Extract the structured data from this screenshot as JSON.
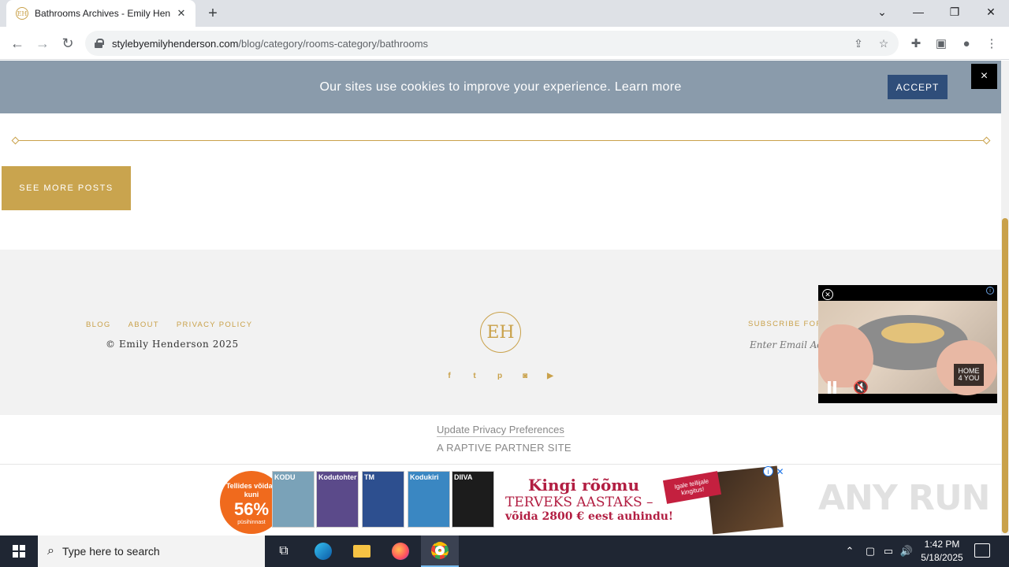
{
  "browser": {
    "tab_title": "Bathrooms Archives - Emily Hen",
    "tab_favicon": "EH",
    "url_host": "stylebyemilyhenderson.com",
    "url_path": "/blog/category/rooms-category/bathrooms"
  },
  "cookie_bar": {
    "text": "Our sites use cookies to improve your experience.",
    "learn_more": "Learn more",
    "accept_label": "ACCEPT",
    "close_label": "×"
  },
  "main": {
    "see_more_label": "SEE MORE POSTS"
  },
  "footer": {
    "nav": [
      "BLOG",
      "ABOUT",
      "PRIVACY POLICY"
    ],
    "copyright": "© Emily Henderson 2025",
    "logo_text": "EH",
    "socials": [
      "facebook-icon",
      "twitter-icon",
      "pinterest-icon",
      "instagram-icon",
      "youtube-icon"
    ],
    "subscribe_label": "SUBSCRIBE FOR",
    "email_placeholder": "Enter Email Ad"
  },
  "legal": {
    "privacy_link": "Update Privacy Preferences",
    "partner": "A RAPTIVE PARTNER SITE"
  },
  "video": {
    "brand_line1": "HOME",
    "brand_line2": "4 YOU"
  },
  "ad": {
    "badge_line1": "Tellides võidad kuni",
    "badge_percent": "56%",
    "badge_line3": "püsihinnast",
    "magazines": [
      "KODU",
      "Kodutohter",
      "TM",
      "Kodukiri",
      "DIIVA"
    ],
    "headline": "Kingi rõõmu",
    "sub1": "TERVEKS AASTAKS –",
    "sub2": "võida 2800 € eest auhindu!",
    "ribbon": "Igale tellijale kingitus!"
  },
  "watermark": "ANY RUN",
  "taskbar": {
    "search_placeholder": "Type here to search",
    "time": "1:42 PM",
    "date": "5/18/2025"
  },
  "colors": {
    "gold": "#c9a14a",
    "cookie_bar": "#8a9bab",
    "accept": "#2f4e7a",
    "footer_bg": "#f2f2f2"
  }
}
